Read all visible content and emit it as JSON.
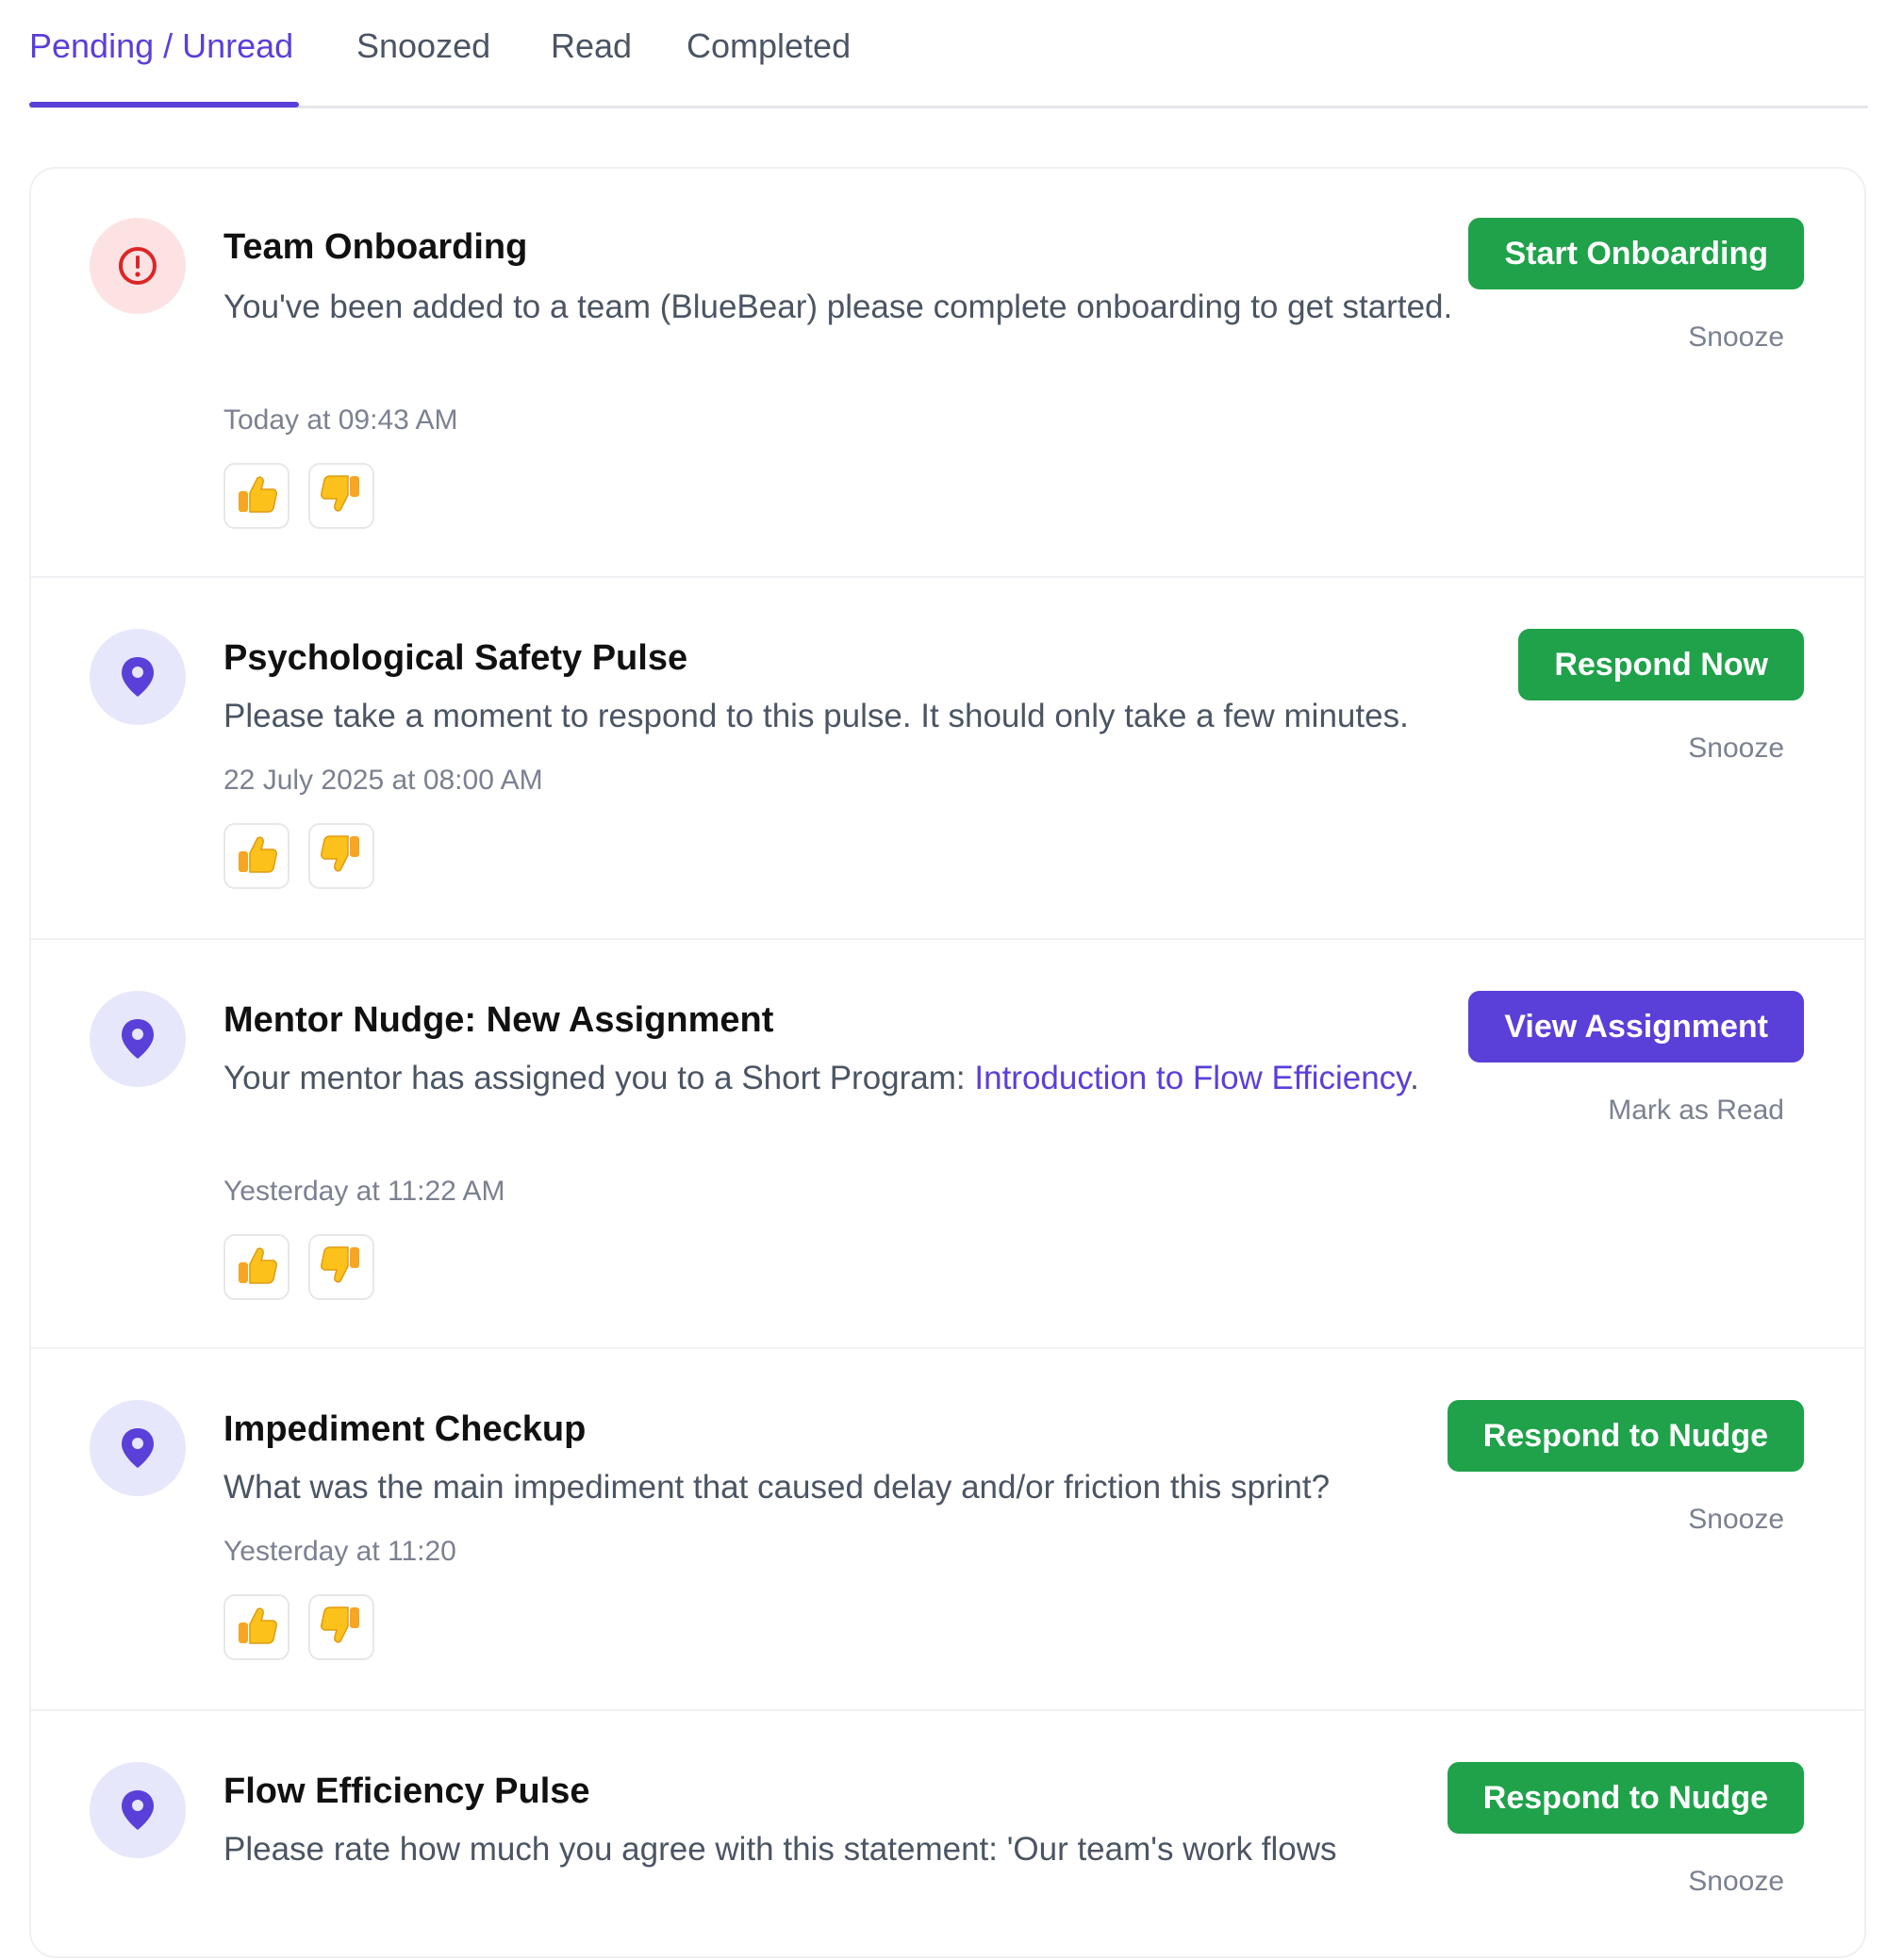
{
  "tabs": [
    {
      "label": "Pending / Unread",
      "active": true
    },
    {
      "label": "Snoozed",
      "active": false
    },
    {
      "label": "Read",
      "active": false
    },
    {
      "label": "Completed",
      "active": false
    }
  ],
  "accent_color": "#5b3fd9",
  "primary_action_color": "#1fa24a",
  "notifications": [
    {
      "icon": "alert-icon",
      "title": "Team Onboarding",
      "description": "You've been added to a team (BlueBear) please complete onboarding to get started.",
      "time": "Today at 09:43 AM",
      "action_label": "Start Onboarding",
      "secondary_label": "Snooze"
    },
    {
      "icon": "location-pin-icon",
      "title": "Psychological Safety Pulse",
      "description": "Please take a moment to respond to this pulse. It should only take a few minutes.",
      "time": "22 July 2025 at 08:00 AM",
      "action_label": "Respond Now",
      "secondary_label": "Snooze"
    },
    {
      "icon": "location-pin-icon",
      "title": "Mentor Nudge: New Assignment",
      "description_prefix": "Your mentor has assigned you to a Short Program: ",
      "description_link": "Introduction to Flow Efficiency",
      "description_suffix": ".",
      "time": "Yesterday at 11:22 AM",
      "action_label": "View Assignment",
      "secondary_label": "Mark as Read"
    },
    {
      "icon": "location-pin-icon",
      "title": "Impediment Checkup",
      "description": "What was the main impediment that caused delay and/or friction this sprint?",
      "time": "Yesterday at 11:20",
      "action_label": "Respond to Nudge",
      "secondary_label": "Snooze"
    },
    {
      "icon": "location-pin-icon",
      "title": "Flow Efficiency Pulse",
      "description": "Please rate how much you agree with this statement: 'Our team's work flows",
      "action_label": "Respond to Nudge",
      "secondary_label": "Snooze"
    }
  ],
  "reactions": {
    "thumbs_up": "👍",
    "thumbs_down": "👎"
  }
}
